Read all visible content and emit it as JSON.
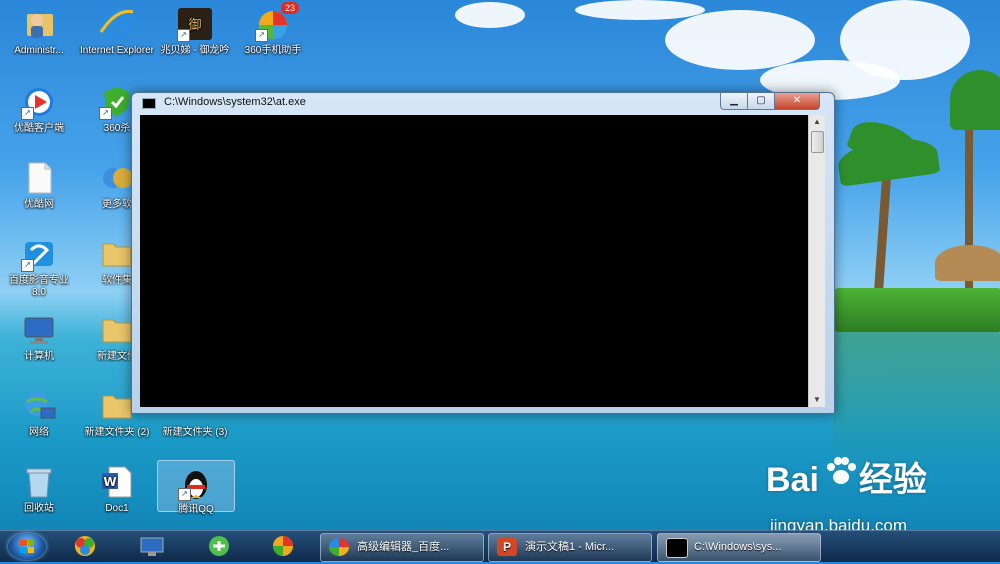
{
  "window": {
    "title": "C:\\Windows\\system32\\at.exe",
    "minimize_glyph": "▁",
    "maximize_glyph": "▢",
    "close_glyph": "✕",
    "scroll_up": "▲",
    "scroll_down": "▼"
  },
  "desktop_icons": [
    {
      "label": "Administr...",
      "icon": "user-folder-icon"
    },
    {
      "label": "Internet Explorer",
      "icon": "internet-explorer-icon"
    },
    {
      "label": "兆贝娣 - 御龙吟",
      "icon": "game-icon"
    },
    {
      "label": "360手机助手",
      "icon": "360-phone-assistant-icon",
      "badge": "23"
    },
    {
      "label": "优酷客户端",
      "icon": "youku-icon"
    },
    {
      "label": "360杀",
      "icon": "360-security-icon"
    },
    {
      "label": "优酷网",
      "icon": "blank-document-icon"
    },
    {
      "label": "更多软",
      "icon": "software-icon"
    },
    {
      "label": "百度影音专业 8.0",
      "icon": "media-player-icon"
    },
    {
      "label": "软件集",
      "icon": "folder-icon"
    },
    {
      "label": "计算机",
      "icon": "computer-icon"
    },
    {
      "label": "新建文件",
      "icon": "folder-icon"
    },
    {
      "label": "网络",
      "icon": "network-icon"
    },
    {
      "label": "新建文件夹 (2)",
      "icon": "folder-icon"
    },
    {
      "label": "新建文件夹 (3)",
      "icon": "folder-icon"
    },
    {
      "label": "回收站",
      "icon": "recycle-bin-icon"
    },
    {
      "label": "Doc1",
      "icon": "word-document-icon"
    },
    {
      "label": "腾讯QQ",
      "icon": "qq-penguin-icon"
    }
  ],
  "taskbar": {
    "pinned": [
      "chrome-like-icon",
      "network-monitor-icon",
      "ie-icon",
      "browser-360-icon"
    ],
    "buttons": [
      {
        "label": "高级编辑器_百度...",
        "icon": "pinwheel-icon"
      },
      {
        "label": "演示文稿1 - Micr...",
        "icon": "powerpoint-icon"
      },
      {
        "label": "C:\\Windows\\sys...",
        "icon": "console-icon",
        "active": true
      }
    ]
  },
  "watermark": {
    "brand_left": "Bai",
    "brand_right": "经验",
    "url": "jingyan.baidu.com"
  },
  "colors": {
    "accent": "#1c5aa6",
    "close_red": "#c7432c"
  }
}
